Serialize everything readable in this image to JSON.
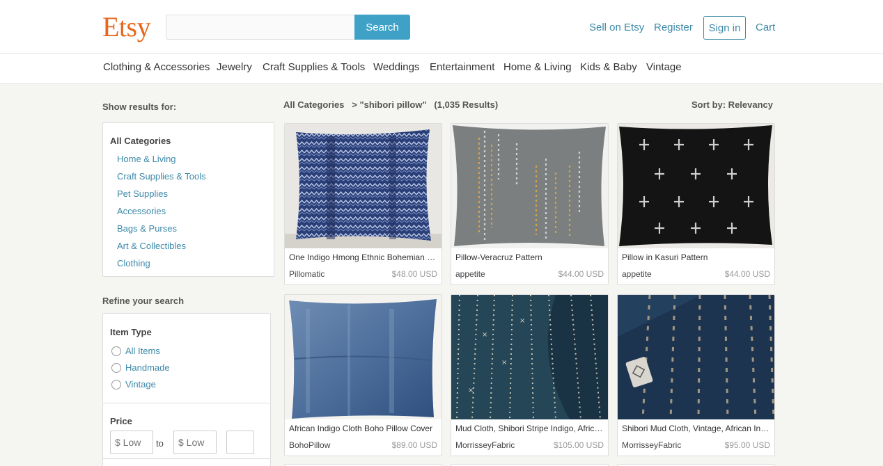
{
  "header": {
    "logo": "Etsy",
    "search": {
      "value": "",
      "placeholder": "",
      "button_label": "Search"
    },
    "links": {
      "sell": "Sell on Etsy",
      "register": "Register",
      "signin": "Sign in",
      "cart": "Cart"
    }
  },
  "categories": [
    "Clothing & Accessories",
    "Jewelry",
    "Craft Supplies & Tools",
    "Weddings",
    "Entertainment",
    "Home & Living",
    "Kids & Baby",
    "Vintage"
  ],
  "sidebar": {
    "show_results_heading": "Show results for:",
    "all_categories": "All Categories",
    "category_links": [
      "Home & Living",
      "Craft Supplies & Tools",
      "Pet Supplies",
      "Accessories",
      "Bags & Purses",
      "Art & Collectibles",
      "Clothing"
    ],
    "refine_heading": "Refine your search",
    "item_type": {
      "title": "Item Type",
      "options": [
        "All Items",
        "Handmade",
        "Vintage"
      ]
    },
    "price": {
      "title": "Price",
      "low_placeholder": "$ Low",
      "high_placeholder": "$ Low",
      "to": "to"
    }
  },
  "results": {
    "breadcrumb": "All Categories   > \"shibori pillow\"   (1,035 Results)",
    "sort": "Sort by: Relevancy"
  },
  "listings": [
    {
      "title": "One Indigo Hmong Ethnic Bohemian Pillow Cover",
      "shop": "Pillomatic",
      "price": "$48.00 USD",
      "image": "indigo-pillow"
    },
    {
      "title": "Pillow-Veracruz Pattern",
      "shop": "appetite",
      "price": "$44.00 USD",
      "image": "grey-pillow"
    },
    {
      "title": "Pillow in Kasuri Pattern",
      "shop": "appetite",
      "price": "$44.00 USD",
      "image": "black-pillow"
    },
    {
      "title": "African Indigo Cloth Boho Pillow Cover",
      "shop": "BohoPillow",
      "price": "$89.00 USD",
      "image": "faded-indigo-pillow"
    },
    {
      "title": "Mud Cloth, Shibori Stripe Indigo, African Textile",
      "shop": "MorrisseyFabric",
      "price": "$105.00 USD",
      "image": "mud-cloth"
    },
    {
      "title": "Shibori Mud Cloth, Vintage, African Indigo",
      "shop": "MorrisseyFabric",
      "price": "$95.00 USD",
      "image": "shibori-cloth"
    }
  ],
  "colors": {
    "brand": "#e8661a",
    "link": "#3c89a8",
    "search_button": "#3fa1c6",
    "background": "#f5f5f1"
  }
}
